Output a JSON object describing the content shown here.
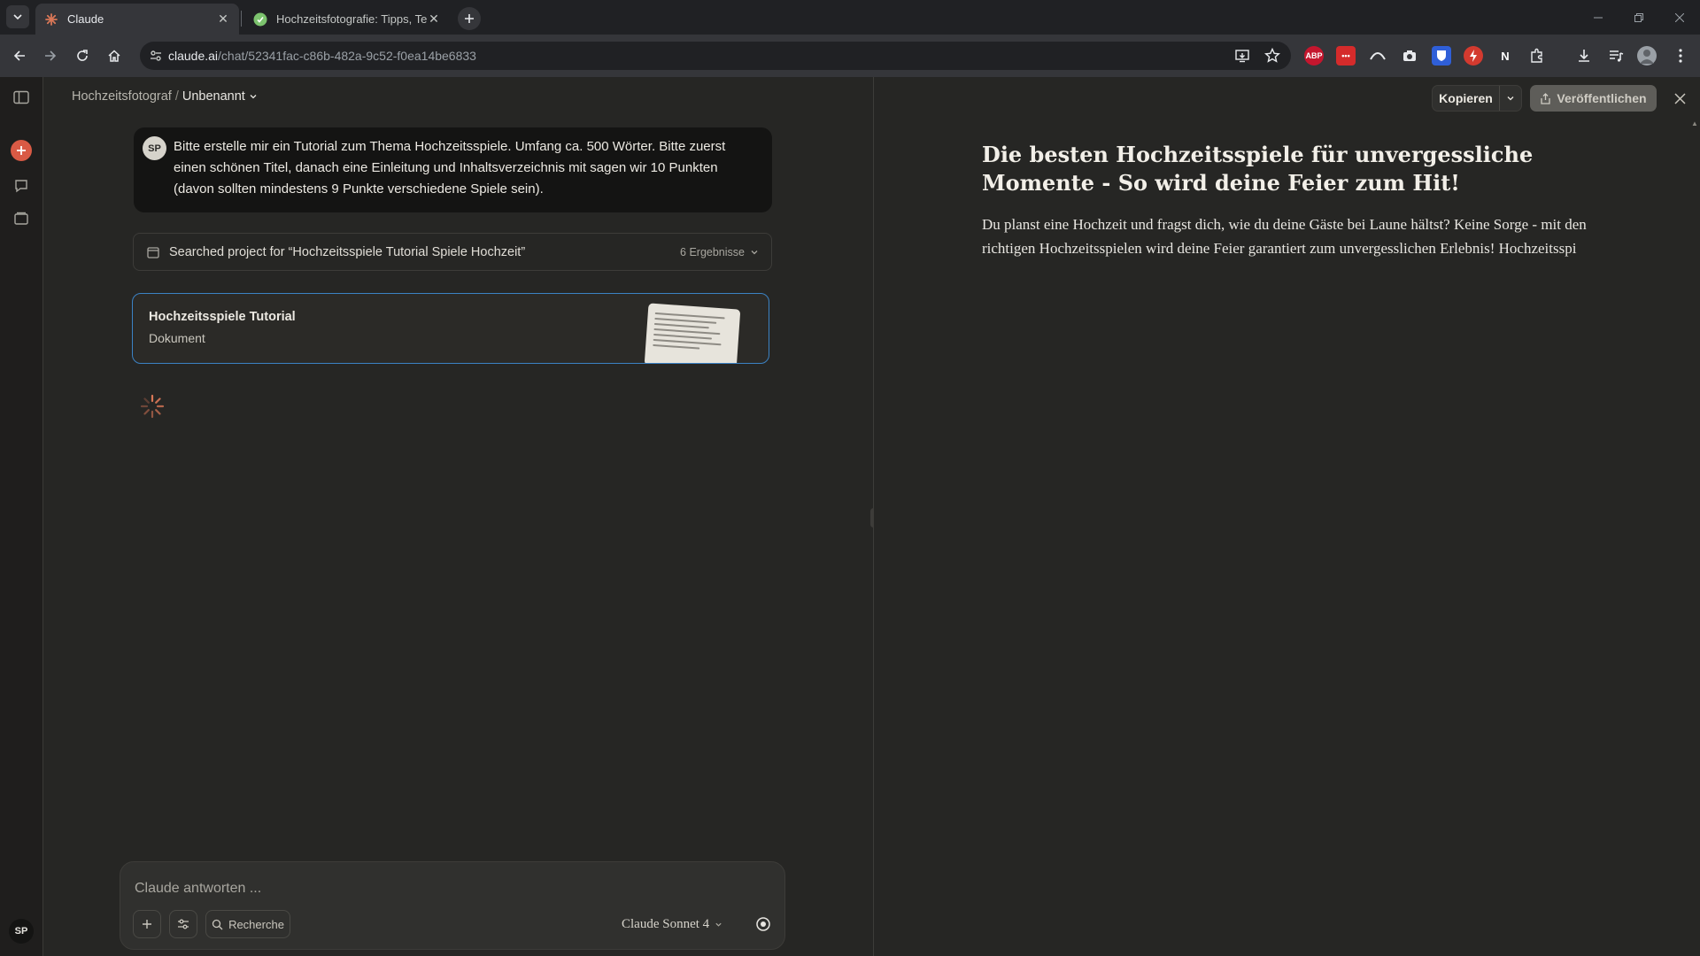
{
  "browser": {
    "tabs": [
      {
        "title": "Claude",
        "active": true
      },
      {
        "title": "Hochzeitsfotografie: Tipps, Tec",
        "active": false
      }
    ],
    "url": {
      "host": "claude.ai",
      "path": "/chat/52341fac-c86b-482a-9c52-f0ea14be6833"
    },
    "extensions": [
      "ABP",
      "•••",
      "N"
    ]
  },
  "app": {
    "breadcrumb": {
      "project": "Hochzeitsfotograf",
      "separator": "/",
      "current": "Unbenannt"
    },
    "user_initials": "SP",
    "user_message": "Bitte erstelle mir ein Tutorial zum Thema Hochzeitsspiele. Umfang ca. 500 Wörter. Bitte zuerst einen schönen Titel, danach eine Einleitung und Inhaltsverzeichnis mit sagen wir 10 Punkten (davon sollten mindestens 9 Punkte verschiedene Spiele sein).",
    "search_card": {
      "text": "Searched project for “Hochzeitsspiele Tutorial Spiele Hochzeit”",
      "count": "6 Ergebnisse"
    },
    "doc_card": {
      "title": "Hochzeitsspiele Tutorial",
      "subtitle": "Dokument"
    },
    "composer": {
      "placeholder": "Claude antworten ...",
      "research_label": "Recherche",
      "model": "Claude Sonnet 4"
    }
  },
  "artifact": {
    "copy_label": "Kopieren",
    "publish_label": "Veröffentlichen",
    "title": "Die besten Hochzeitsspiele für unvergessliche Momente - So wird deine Feier zum Hit!",
    "body": "Du planst eine Hochzeit und fragst dich, wie du deine Gäste bei Laune hältst? Keine Sorge - mit den richtigen Hochzeitsspielen wird deine Feier garantiert zum unvergesslichen Erlebnis! Hochzeitsspi"
  },
  "colors": {
    "accent": "#d95a45",
    "selection_border": "#3b82c4",
    "background": "#262624"
  }
}
